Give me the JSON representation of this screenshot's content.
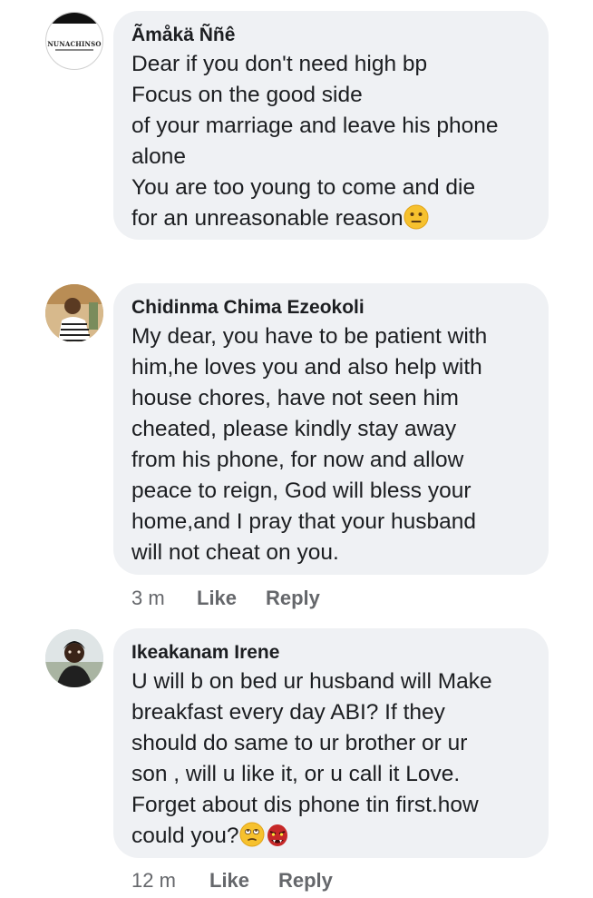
{
  "comments": [
    {
      "author": "Ãmåkä Ññê",
      "avatar_text": "NUNACHINSO",
      "lines": [
        "Dear if you don't need high bp",
        "Focus on the good side",
        "of your marriage and leave his phone",
        "alone",
        "You are too young to come and die",
        "for an unreasonable reason"
      ],
      "emojis": [
        "neutral-face-emoji"
      ]
    },
    {
      "author": "Chidinma Chima Ezeokoli",
      "lines": [
        "My dear, you have to be patient with",
        "him,he loves you and also help with",
        "house chores, have not seen him",
        "cheated, please kindly stay away",
        "from his phone, for now and allow",
        "peace to reign, God will bless your",
        "home,and I pray that your husband",
        "will not cheat on you."
      ],
      "time": "3 m",
      "like": "Like",
      "reply": "Reply"
    },
    {
      "author": "Ikeakanam Irene",
      "lines": [
        "U will b on bed ur husband will Make",
        "breakfast every day ABI? If they",
        "should do same to ur brother or ur",
        "son , will u like it, or u call it Love.",
        "Forget about dis phone tin first.how",
        "could you?"
      ],
      "emojis": [
        "eye-roll-face-emoji",
        "ogre-face-emoji"
      ],
      "time": "12 m",
      "like": "Like",
      "reply": "Reply"
    }
  ]
}
